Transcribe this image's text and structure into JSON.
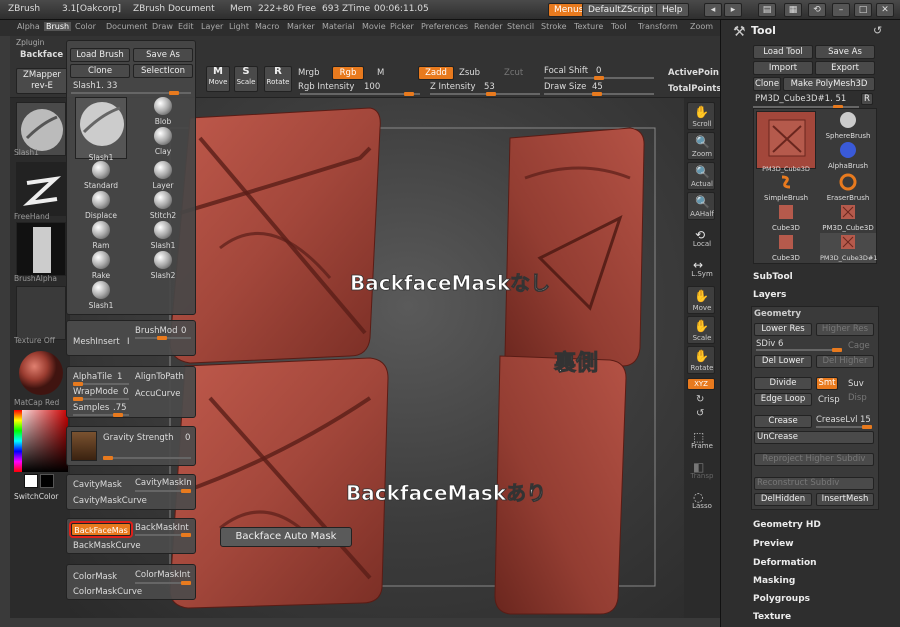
{
  "titlebar": {
    "app": "ZBrush",
    "version": "3.1[Oakcorp]",
    "doc": "ZBrush Document",
    "mem": "Mem",
    "mem_value": "222+80",
    "free": "Free",
    "free_value": "693",
    "ztime": "ZTime",
    "ztime_value": "00:06:11.05",
    "menus_btn": "Menus",
    "script_btn": "DefaultZScript",
    "help_btn": "Help"
  },
  "menubar": [
    "Alpha",
    "Brush",
    "Color",
    "Document",
    "Draw",
    "Edit",
    "Layer",
    "Light",
    "Macro",
    "Marker",
    "Material",
    "Movie",
    "Picker",
    "Preferences",
    "Render",
    "Stencil",
    "Stroke",
    "Texture",
    "Tool",
    "Transform",
    "Zoom"
  ],
  "zplugin": "Zplugin",
  "backface_tab": "Backface",
  "topshelf": {
    "zmapper": "ZMapper",
    "zmapper_sub": "rev-E",
    "move": "Move",
    "scale": "Scale",
    "rotate": "Rotate",
    "mrgb": "Mrgb",
    "rgb": "Rgb",
    "m": "M",
    "zadd": "Zadd",
    "zsub": "Zsub",
    "zcut": "Zcut",
    "rgb_intensity_label": "Rgb Intensity",
    "rgb_intensity_value": "100",
    "z_intensity_label": "Z Intensity",
    "z_intensity_value": "53",
    "focal_shift_label": "Focal Shift",
    "focal_shift_value": "0",
    "draw_size_label": "Draw Size",
    "draw_size_value": "45",
    "active_points": "ActivePoin",
    "total_points": "TotalPoints"
  },
  "leftshelf": {
    "slash1": "Slash1",
    "freehand": "FreeHand",
    "brushalpha": "BrushAlpha",
    "texture": "Texture Off",
    "matcap": "MatCap Red",
    "switchcolor": "SwitchColor"
  },
  "brushpopup": {
    "load_brush": "Load Brush",
    "save_as": "Save As",
    "clone": "Clone",
    "select_icon": "SelectIcon",
    "current": "Slash1. 33",
    "items": [
      "Slash1",
      "Blob",
      "Clay",
      "Standard",
      "Layer",
      "Displace",
      "Stitch2",
      "Ram",
      "Slash1",
      "Rake",
      "Slash2",
      "Slash1"
    ]
  },
  "brushpanels": {
    "meshinsert": "MeshInsert",
    "meshinsert_value": "I",
    "brushmod": "BrushMod",
    "brushmod_value": "0",
    "alphatile": "AlphaTile",
    "alphatile_value": "1",
    "aligntopath": "AlignToPath",
    "wrapmode": "WrapMode",
    "wrapmode_value": "0",
    "accucurve": "AccuCurve",
    "samples": "Samples",
    "samples_value": ".75",
    "gravity": "Gravity Strength",
    "gravity_value": "0",
    "cavitymask": "CavityMask",
    "cavitymaskint": "CavityMaskIn",
    "cavitymaskcurve": "CavityMaskCurve",
    "backfacemask": "BackFaceMas",
    "backmaskint": "BackMaskInt",
    "backmaskcurve": "BackMaskCurve",
    "colormask": "ColorMask",
    "colormaskint": "ColorMaskInt",
    "colormaskcurve": "ColorMaskCurve"
  },
  "tooltip": "Backface Auto Mask",
  "annotations": {
    "without": "BackfaceMaskなし",
    "back": "裏側",
    "with": "BackfaceMaskあり"
  },
  "rightshelf": [
    "Scroll",
    "Zoom",
    "Actual",
    "AAHalf",
    "Local",
    "L.Sym",
    "Move",
    "Scale",
    "Rotate",
    "XYZ",
    "Frame",
    "Transp",
    "Lasso"
  ],
  "toolpanel": {
    "title": "Tool",
    "load_tool": "Load Tool",
    "save_as": "Save As",
    "import": "Import",
    "export": "Export",
    "clone": "Clone",
    "make_polymesh": "Make PolyMesh3D",
    "current": "PM3D_Cube3D#1. 51",
    "r": "R",
    "thumbs": [
      "PM3D_Cube3D",
      "SphereBrush",
      "AlphaBrush",
      "SimpleBrush",
      "EraserBrush",
      "Cube3D",
      "PM3D_Cube3D",
      "Cube3D",
      "PM3D_Cube3D#1"
    ],
    "subtool": "SubTool",
    "layers": "Layers",
    "geometry": "Geometry",
    "lower_res": "Lower Res",
    "higher_res": "Higher Res",
    "sdiv": "SDiv",
    "sdiv_value": "6",
    "cage": "Cage",
    "del_lower": "Del Lower",
    "del_higher": "Del Higher",
    "divide": "Divide",
    "smt": "Smt",
    "suv": "Suv",
    "edge_loop": "Edge Loop",
    "crisp": "Crisp",
    "disp": "Disp",
    "crease": "Crease",
    "creaselvl": "CreaseLvl",
    "creaselvl_value": "15",
    "uncrease": "UnCrease",
    "reproject": "Reproject Higher Subdiv",
    "reconstruct": "Reconstruct Subdiv",
    "delhidden": "DelHidden",
    "insertmesh": "InsertMesh",
    "sections": [
      "Geometry HD",
      "Preview",
      "Deformation",
      "Masking",
      "Polygroups",
      "Texture"
    ]
  },
  "colors": {
    "accent": "#e87a1e",
    "clay": "#a3473b",
    "highlight_ring": "#e0201a"
  }
}
